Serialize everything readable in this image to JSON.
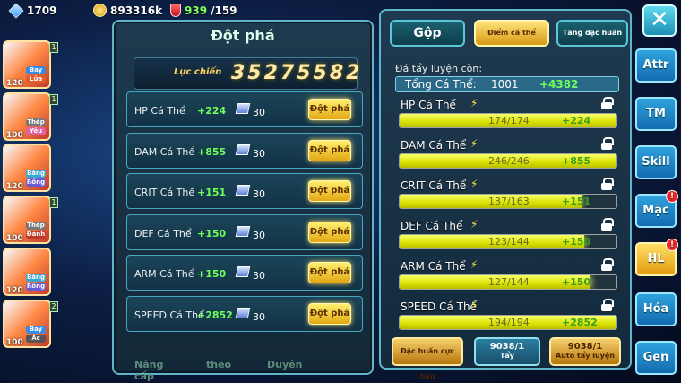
{
  "resources": {
    "gems": "1709",
    "gold": "893316k",
    "energy": "939",
    "energy_max": "/159"
  },
  "team": [
    {
      "level": "120",
      "tag1": "Bay",
      "tag2": "Lửa",
      "num": "1"
    },
    {
      "level": "100",
      "tag1": "Thép",
      "tag2": "Yêu",
      "num": "1"
    },
    {
      "level": "120",
      "tag1": "Băng",
      "tag2": "Rồng",
      "num": ""
    },
    {
      "level": "100",
      "tag1": "Thép",
      "tag2": "Đánh",
      "num": "1"
    },
    {
      "level": "120",
      "tag1": "Băng",
      "tag2": "Rồng",
      "num": ""
    },
    {
      "level": "100",
      "tag1": "Bay",
      "tag2": "Ác",
      "num": "2"
    }
  ],
  "breakthrough": {
    "title": "Đột phá",
    "power_label": "Lực chiến",
    "power_value": "35275582",
    "rows": [
      {
        "name": "HP Cá Thể",
        "plus": "+224",
        "cost": "30",
        "button": "Đột phá"
      },
      {
        "name": "DAM Cá Thể",
        "plus": "+855",
        "cost": "30",
        "button": "Đột phá"
      },
      {
        "name": "CRIT Cá Thể",
        "plus": "+151",
        "cost": "30",
        "button": "Đột phá"
      },
      {
        "name": "DEF Cá Thể",
        "plus": "+150",
        "cost": "30",
        "button": "Đột phá"
      },
      {
        "name": "ARM Cá Thể",
        "plus": "+150",
        "cost": "30",
        "button": "Đột phá"
      },
      {
        "name": "SPEED Cá Thể",
        "plus": "+2852",
        "cost": "30",
        "button": "Đột phá"
      }
    ],
    "bottom_tabs": [
      "Nâng cấp",
      "theo",
      "Duyên"
    ]
  },
  "training": {
    "tabs": [
      "Gộp",
      "Điểm cá thể",
      "Tăng đặc huấn"
    ],
    "remaining_label": "Đá tẩy luyện còn:",
    "total_label": "Tổng Cá Thể:",
    "total_value": "1001",
    "total_plus": "+4382",
    "stats": [
      {
        "name": "HP Cá Thể",
        "value": "174/174",
        "plus": "+224",
        "fill": 1.0
      },
      {
        "name": "DAM Cá Thể",
        "value": "246/246",
        "plus": "+855",
        "fill": 1.0
      },
      {
        "name": "CRIT Cá Thể",
        "value": "137/163",
        "plus": "+151",
        "fill": 0.84
      },
      {
        "name": "DEF Cá Thể",
        "value": "123/144",
        "plus": "+150",
        "fill": 0.85
      },
      {
        "name": "ARM Cá Thể",
        "value": "127/144",
        "plus": "+150",
        "fill": 0.88
      },
      {
        "name": "SPEED Cá Thể",
        "value": "194/194",
        "plus": "+2852",
        "fill": 1.0
      }
    ],
    "actions": {
      "special": "Đặc huấn cực hạn",
      "wash_count": "9038/1",
      "wash_label": "Tẩy",
      "auto_count": "9038/1",
      "auto_label": "Auto tẩy luyện"
    }
  },
  "side_nav": [
    {
      "label": "Attr",
      "badge": ""
    },
    {
      "label": "TM",
      "badge": ""
    },
    {
      "label": "Skill",
      "badge": ""
    },
    {
      "label": "Mặc",
      "badge": "!"
    },
    {
      "label": "HL",
      "badge": "!"
    },
    {
      "label": "Hóa",
      "badge": ""
    },
    {
      "label": "Gen",
      "badge": ""
    }
  ],
  "close_symbol": "✕"
}
